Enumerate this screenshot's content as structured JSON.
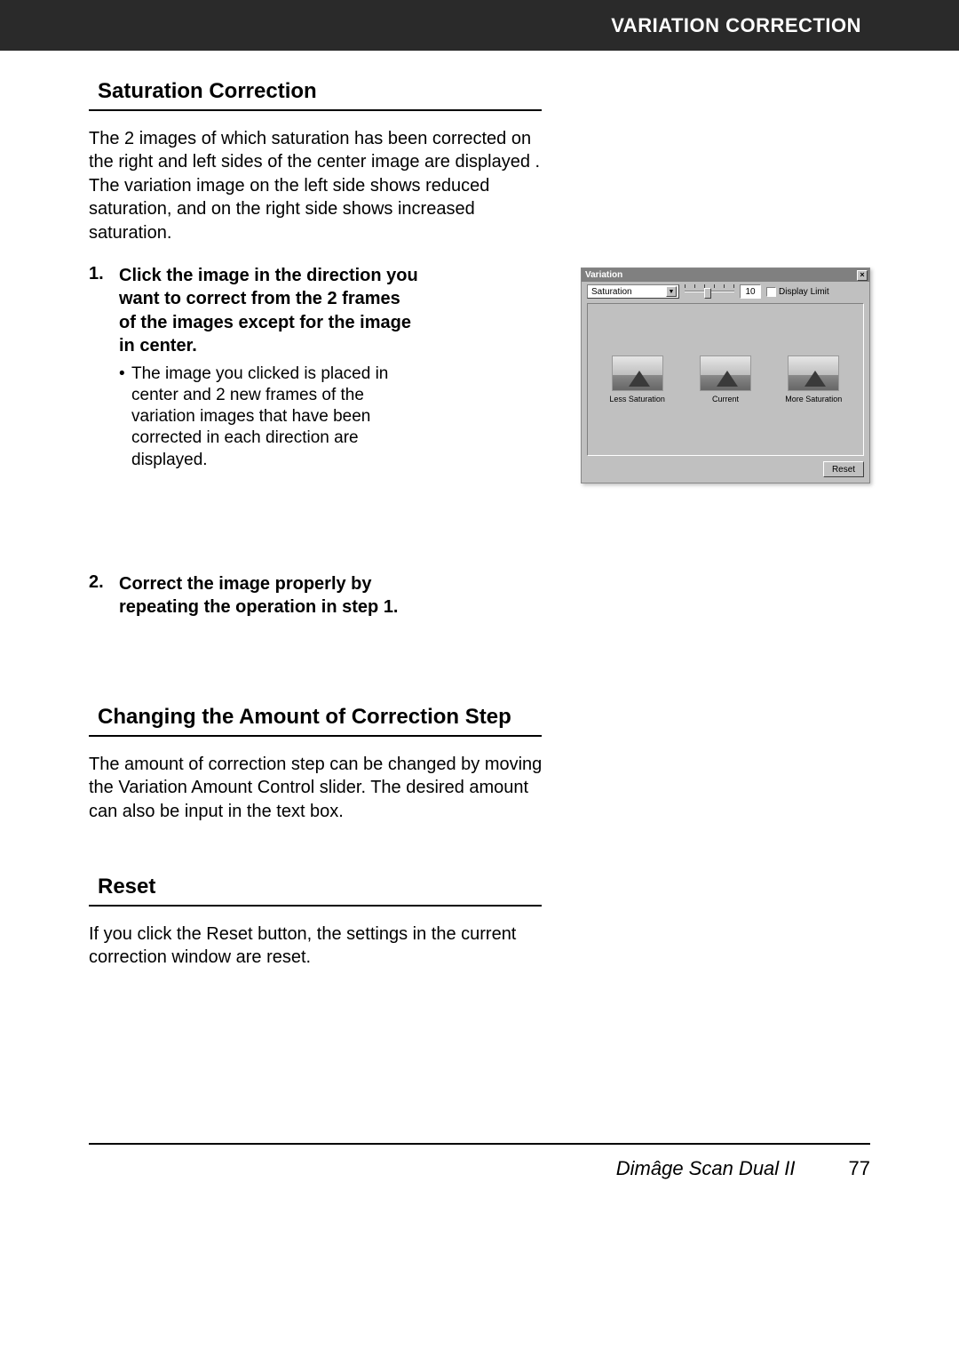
{
  "header": {
    "title": "VARIATION CORRECTION"
  },
  "section1": {
    "heading": "Saturation Correction",
    "intro": "The 2 images of which saturation has been corrected on the right and left sides of the center image are displayed . The variation image on the left side shows reduced saturation, and on the right side shows increased saturation.",
    "step1_num": "1.",
    "step1_title": "Click the image in the direction you want to correct from the 2 frames of the images except for the image in center.",
    "step1_bullet": "The image you clicked is placed in center and 2 new frames of the variation images that have been corrected in each direction are displayed.",
    "step2_num": "2.",
    "step2_title": "Correct the image properly by repeating the operation in step 1."
  },
  "section2": {
    "heading": "Changing the Amount of Correction Step",
    "body": "The amount of correction step can be changed by moving the Variation Amount Control slider. The desired amount can also be input in the text box."
  },
  "section3": {
    "heading": "Reset",
    "body": "If you click the Reset button, the settings in the current correction window are reset."
  },
  "dialog": {
    "title": "Variation",
    "dropdown": "Saturation",
    "amount": "10",
    "display_limit": "Display Limit",
    "thumbs": {
      "less": "Less Saturation",
      "current": "Current",
      "more": "More Saturation"
    },
    "reset": "Reset"
  },
  "footer": {
    "product": "Dimâge Scan Dual II",
    "page": "77"
  }
}
